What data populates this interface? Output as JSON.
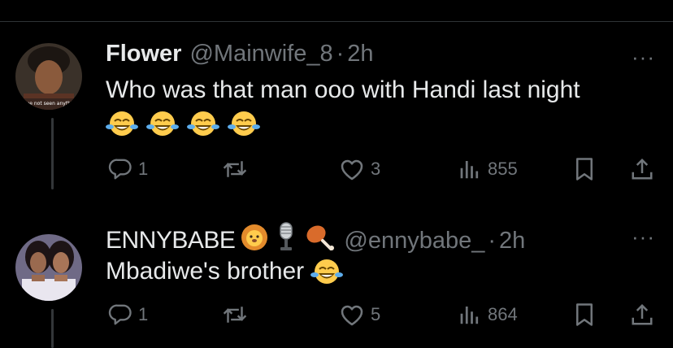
{
  "tweets": [
    {
      "display_name": "Flower",
      "handle": "@Mainwife_8",
      "separator": "·",
      "time": "2h",
      "text": "Who was that man ooo with Handi last night",
      "emojis": [
        "😂",
        "😂",
        "😂",
        "😂"
      ],
      "avatar_caption": "we not seen anythi",
      "more_label": "···",
      "replies": "1",
      "retweets": "",
      "likes": "3",
      "views": "855"
    },
    {
      "display_name": "ENNYBABE",
      "name_badges": [
        "lion-emoji",
        "microphone-emoji",
        "chicken-leg-emoji"
      ],
      "handle": "@ennybabe_",
      "separator": "·",
      "time": "2h",
      "text": "Mbadiwe's brother",
      "emojis": [
        "😂"
      ],
      "more_label": "···",
      "replies": "1",
      "retweets": "",
      "likes": "5",
      "views": "864"
    }
  ],
  "colors": {
    "background": "#000000",
    "primary_text": "#e7e9ea",
    "secondary_text": "#71767b",
    "divider": "#2f3336"
  }
}
